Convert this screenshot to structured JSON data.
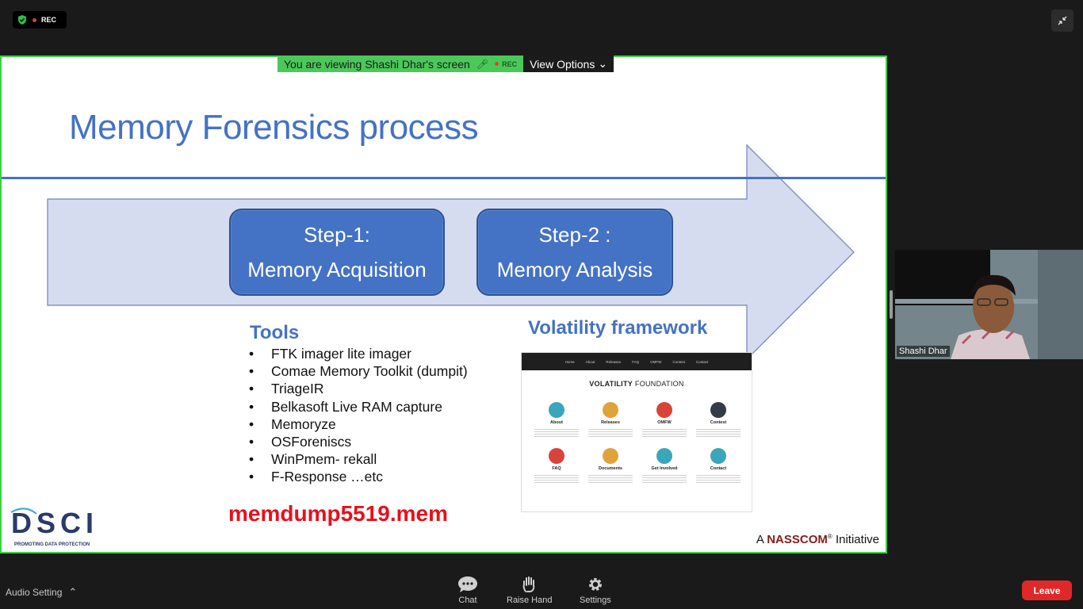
{
  "top": {
    "rec_label": "REC"
  },
  "banner": {
    "viewing": "You are viewing Shashi Dhar's screen",
    "rec_label": "REC",
    "view_options": "View Options"
  },
  "slide": {
    "title": "Memory Forensics process",
    "step1": {
      "line1": "Step-1:",
      "line2": "Memory Acquisition"
    },
    "step2": {
      "line1": "Step-2 :",
      "line2": "Memory Analysis"
    },
    "tools_title": "Tools",
    "tools": [
      "FTK imager lite imager",
      "Comae Memory Toolkit (dumpit)",
      "TriageIR",
      "Belkasoft  Live RAM capture",
      "Memoryze",
      "OSForeniscs",
      "WinPmem- rekall",
      "F-Response …etc"
    ],
    "vol_title": "Volatility framework",
    "mem_file": "memdump5519.mem",
    "nasscom": {
      "prefix": "A",
      "brand": "NASSCOM",
      "reg": "®",
      "suffix": "Initiative"
    },
    "dsci": {
      "name": "DSCI",
      "tagline": "PROMOTING DATA PROTECTION"
    },
    "vol_site": {
      "nav": [
        "Home",
        "About",
        "Releases",
        "FAQ",
        "OMFW",
        "Contest",
        "Contact"
      ],
      "heading_bold": "VOLATILITY",
      "heading_rest": "FOUNDATION",
      "items": [
        {
          "label": "About",
          "color": "#3aa6b9"
        },
        {
          "label": "Releases",
          "color": "#e0a33a"
        },
        {
          "label": "OMFW",
          "color": "#d9443a"
        },
        {
          "label": "Contest",
          "color": "#333a48"
        },
        {
          "label": "FAQ",
          "color": "#d9443a"
        },
        {
          "label": "Documents",
          "color": "#e0a33a"
        },
        {
          "label": "Get Involved",
          "color": "#3aa6b9"
        },
        {
          "label": "Contact",
          "color": "#3aa6b9"
        }
      ]
    }
  },
  "video": {
    "name": "Shashi Dhar"
  },
  "toolbar": {
    "audio": "Audio Setting",
    "chat": "Chat",
    "raise_hand": "Raise Hand",
    "settings": "Settings",
    "leave": "Leave"
  }
}
